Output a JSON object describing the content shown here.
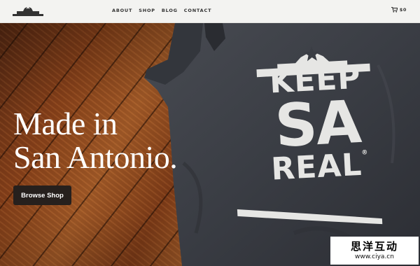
{
  "header": {
    "logo_icon": "alamo-star-logo",
    "nav": [
      {
        "label": "ABOUT"
      },
      {
        "label": "SHOP"
      },
      {
        "label": "BLOG"
      },
      {
        "label": "CONTACT"
      }
    ],
    "cart": {
      "icon": "cart-icon",
      "amount": "$0"
    }
  },
  "hero": {
    "headline_line1": "Made in",
    "headline_line2": "San Antonio.",
    "cta_label": "Browse Shop",
    "shirt_print": {
      "line1": "KEEP",
      "line2": "SA",
      "line3": "REAL",
      "mark": "®"
    }
  },
  "watermark": {
    "title": "思洋互动",
    "url": "www.ciya.cn"
  },
  "colors": {
    "header_bg": "#f3f3f1",
    "nav_text": "#333333",
    "shirt": "#3b3e45",
    "print": "#e6e6e4",
    "button_bg": "#26201d"
  }
}
